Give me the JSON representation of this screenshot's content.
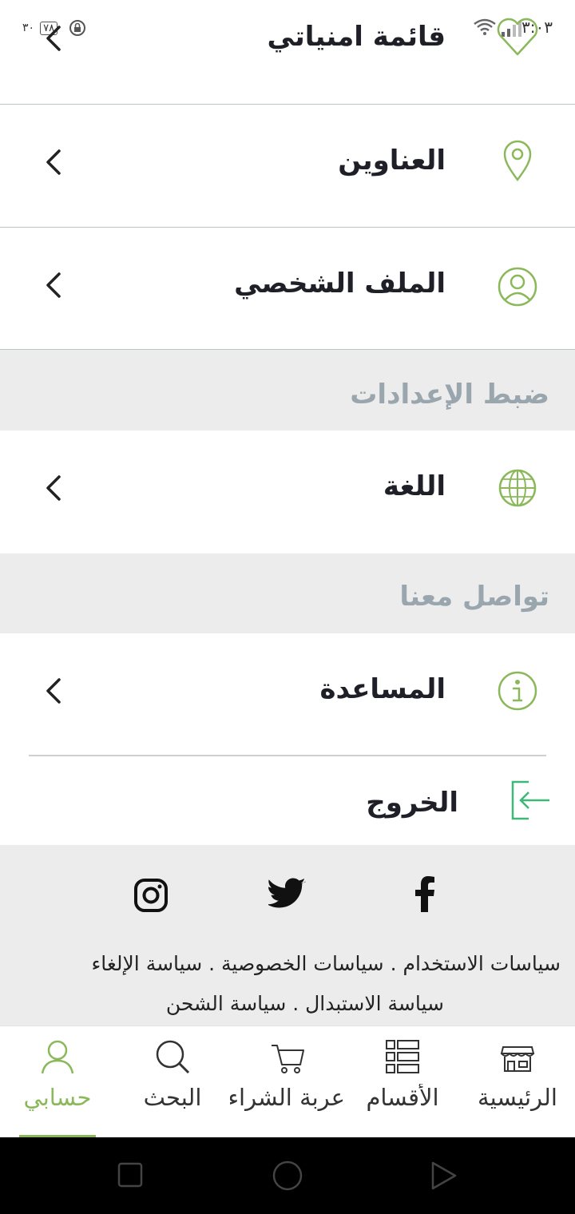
{
  "status_bar": {
    "time": "٣:٠٣",
    "battery": "٧٨",
    "extra": "٣٠"
  },
  "rows": {
    "wishlist": "قائمة امنياتي",
    "addresses": "العناوين",
    "profile": "الملف الشخصي",
    "language": "اللغة",
    "help": "المساعدة",
    "logout": "الخروج"
  },
  "sections": {
    "settings": "ضبط الإعدادات",
    "contact": "تواصل معنا"
  },
  "footer": {
    "social": [
      "facebook-icon",
      "twitter-icon",
      "instagram-icon"
    ],
    "policy_line1": "سياسات الاستخدام  .  سياسات الخصوصية  .  سياسة الإلغاء",
    "policy_line2": "سياسة الاستبدال  .  سياسة الشحن"
  },
  "bottom_nav": {
    "home": "الرئيسية",
    "categories": "الأقسام",
    "cart": "عربة الشراء",
    "search": "البحث",
    "account": "حسابي",
    "active": "account"
  },
  "colors": {
    "accent": "#8bb85a",
    "logout_green": "#3cb878",
    "section_bg": "#ececec",
    "section_text": "#9aa6ae"
  }
}
